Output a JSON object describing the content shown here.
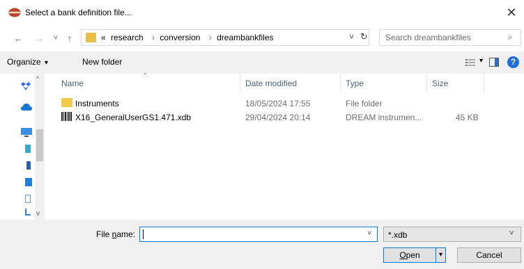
{
  "window": {
    "title": "Select a bank definition file...",
    "close_glyph": "✕"
  },
  "nav": {
    "back_glyph": "←",
    "forward_glyph": "→",
    "recent_glyph": "˅",
    "up_glyph": "↑",
    "breadcrumbs": {
      "overflow": "«",
      "items": [
        "research",
        "conversion",
        "dreambankfiles"
      ],
      "sep": "›"
    },
    "refresh_glyph": "↻",
    "drop_glyph": "˅",
    "search_placeholder": "Search dreambankfiles",
    "search_glyph": "⌕"
  },
  "toolbar": {
    "organize_label": "Organize",
    "organize_arrow": "▾",
    "new_folder_label": "New folder",
    "view_arrow": "▾",
    "help_glyph": "?"
  },
  "columns": {
    "name": "Name",
    "date": "Date modified",
    "type": "Type",
    "size": "Size"
  },
  "files": [
    {
      "name": "Instruments",
      "date": "18/05/2024 17:55",
      "type": "File folder",
      "size": ""
    },
    {
      "name": "X16_GeneralUserGS1.471.xdb",
      "date": "29/04/2024 20:14",
      "type": "DREAM instrumen...",
      "size": "45 KB"
    }
  ],
  "footer": {
    "file_name_label_pre": "File ",
    "file_name_label_accel": "n",
    "file_name_label_post": "ame:",
    "file_name_value": "",
    "filter_value": "*.xdb",
    "open_label_accel": "O",
    "open_label_rest": "pen",
    "open_split_glyph": "▾",
    "cancel_label": "Cancel"
  },
  "colors": {
    "accent": "#0078d7",
    "folder": "#e8bd4a",
    "help": "#1e6fd9"
  }
}
